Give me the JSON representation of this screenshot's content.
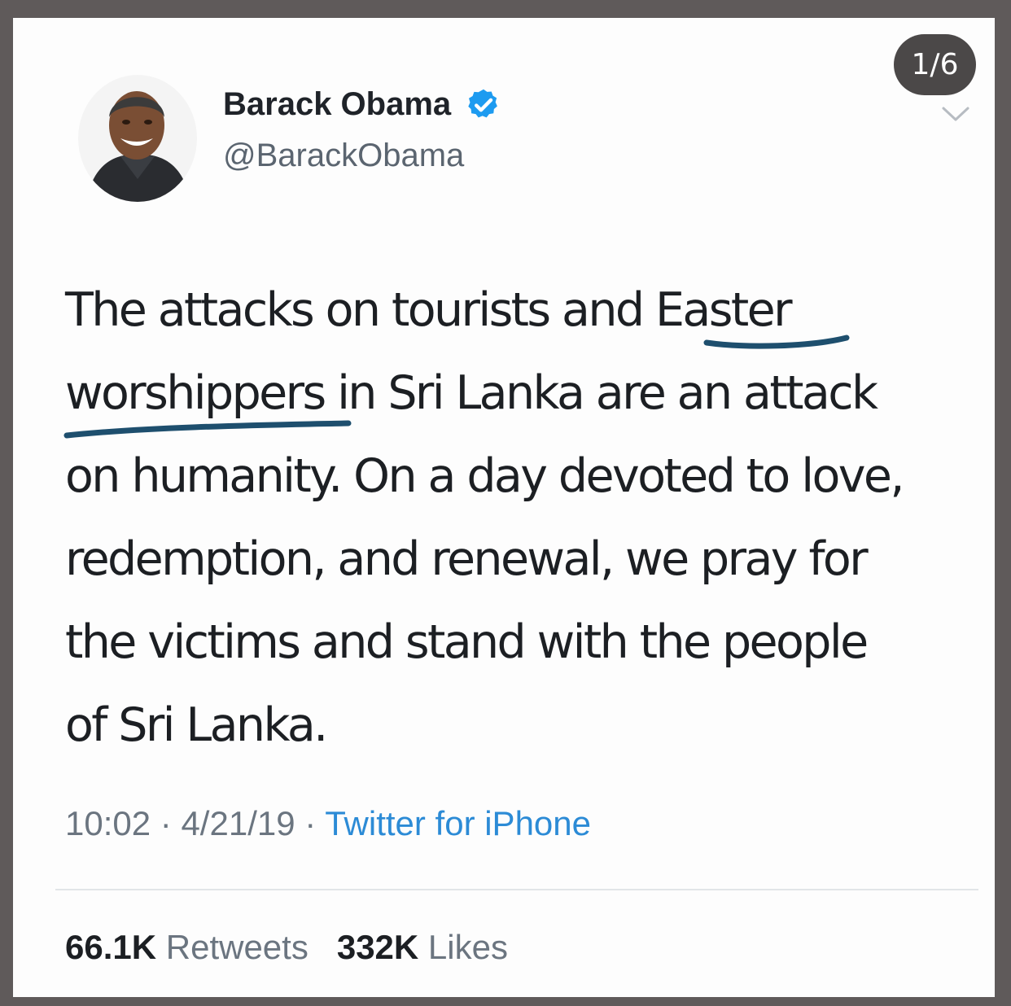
{
  "author": {
    "display_name": "Barack Obama",
    "handle": "@BarackObama",
    "avatar_icon": "profile-photo",
    "verified_icon": "verified-badge-icon"
  },
  "gallery": {
    "page_indicator": "1/6",
    "menu_icon": "chevron-down-icon"
  },
  "tweet": {
    "lines": [
      "The attacks on tourists and Easter",
      "worshippers in Sri Lanka are an attack",
      "on humanity. On a day devoted to love,",
      "redemption, and renewal, we pray for",
      "the victims and stand with the people",
      "of Sri Lanka."
    ],
    "underlined_phrase": "Easter worshippers"
  },
  "meta": {
    "time": "10:02",
    "separator": "·",
    "date": "4/21/19",
    "source": "Twitter for iPhone"
  },
  "stats": {
    "retweets_count": "66.1K",
    "retweets_label": "Retweets",
    "likes_count": "332K",
    "likes_label": "Likes"
  },
  "colors": {
    "background_frame": "#5f5a5a",
    "card": "#fdfdfd",
    "verified_blue": "#1d9bf0",
    "link_blue": "#2c8bd6",
    "underline_ink": "#1e4f6e"
  }
}
